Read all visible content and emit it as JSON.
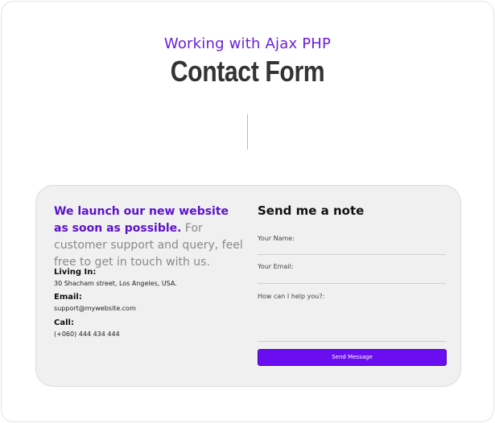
{
  "header": {
    "subtitle": "Working with Ajax PHP",
    "title": "Contact Form"
  },
  "info": {
    "lead_highlight": "We launch our new website as soon as possible.",
    "lead_text": " For customer support and query, feel free to get in touch with us.",
    "living_label": "Living In:",
    "living_value": "30 Shacham street, Los Angeles, USA.",
    "email_label": "Email:",
    "email_value": "support@mywebsite.com",
    "call_label": "Call:",
    "call_value": "(+060) 444 434 444"
  },
  "form": {
    "title": "Send me a note",
    "name_label": "Your Name:",
    "email_label": "Your Email:",
    "message_label": "How can I help you?:",
    "submit_label": "Send Message"
  },
  "colors": {
    "accent": "#6a0df0",
    "subtitle": "#6a1fd9"
  }
}
